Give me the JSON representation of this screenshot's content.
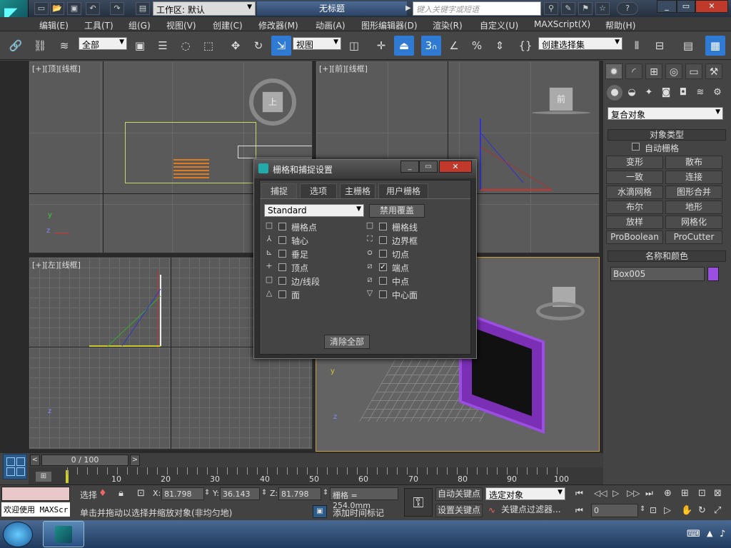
{
  "titlebar": {
    "workspace": "工作区: 默认",
    "doc": "无标题",
    "search_placeholder": "键入关键字或短语",
    "help": "?"
  },
  "menu": [
    "编辑(E)",
    "工具(T)",
    "组(G)",
    "视图(V)",
    "创建(C)",
    "修改器(M)",
    "动画(A)",
    "图形编辑器(D)",
    "渲染(R)",
    "自定义(U)",
    "MAXScript(X)",
    "帮助(H)"
  ],
  "toolbar": {
    "filter": "全部",
    "refcoord": "视图",
    "snap_num": "3",
    "selset": "创建选择集"
  },
  "viewports": {
    "top": "[+][顶][线框]",
    "front": "[+][前][线框]",
    "left": "[+][左][线框]",
    "top_cube": "上",
    "front_cube": "前"
  },
  "cmdpanel": {
    "category": "复合对象",
    "objtype_header": "对象类型",
    "autogrid": "自动栅格",
    "buttons": [
      "变形",
      "散布",
      "一致",
      "连接",
      "水滴网格",
      "图形合并",
      "布尔",
      "地形",
      "放样",
      "网格化",
      "ProBoolean",
      "ProCutter"
    ],
    "name_header": "名称和颜色",
    "object_name": "Box005",
    "object_color": "#9b4fe0"
  },
  "dialog": {
    "title": "栅格和捕捉设置",
    "tabs": [
      "捕捉",
      "选项",
      "主栅格",
      "用户栅格"
    ],
    "type": "Standard",
    "override": "禁用覆盖",
    "left_items": [
      {
        "label": "栅格点",
        "checked": false
      },
      {
        "label": "轴心",
        "checked": false
      },
      {
        "label": "垂足",
        "checked": false
      },
      {
        "label": "顶点",
        "checked": false
      },
      {
        "label": "边/线段",
        "checked": false
      },
      {
        "label": "面",
        "checked": false
      }
    ],
    "right_items": [
      {
        "label": "栅格线",
        "checked": false
      },
      {
        "label": "边界框",
        "checked": false
      },
      {
        "label": "切点",
        "checked": false
      },
      {
        "label": "端点",
        "checked": true
      },
      {
        "label": "中点",
        "checked": false
      },
      {
        "label": "中心面",
        "checked": false
      }
    ],
    "clear_all": "清除全部"
  },
  "timeline": {
    "frame": "0 / 100",
    "ticks": [
      "10",
      "20",
      "30",
      "40",
      "50",
      "60",
      "70",
      "80",
      "90",
      "100"
    ]
  },
  "status": {
    "welcome": "欢迎使用 MAXScr",
    "select_label": "选择",
    "x": "81.798",
    "y": "36.143",
    "z": "81.798",
    "grid": "栅格 = 254.0mm",
    "prompt": "单击并拖动以选择并缩放对象(非均匀地)",
    "add_time_tag": "添加时间标记",
    "auto_key": "自动关键点",
    "set_key": "设置关键点",
    "key_mode": "选定对象",
    "key_filter": "关键点过滤器...",
    "frame_field": "0"
  }
}
